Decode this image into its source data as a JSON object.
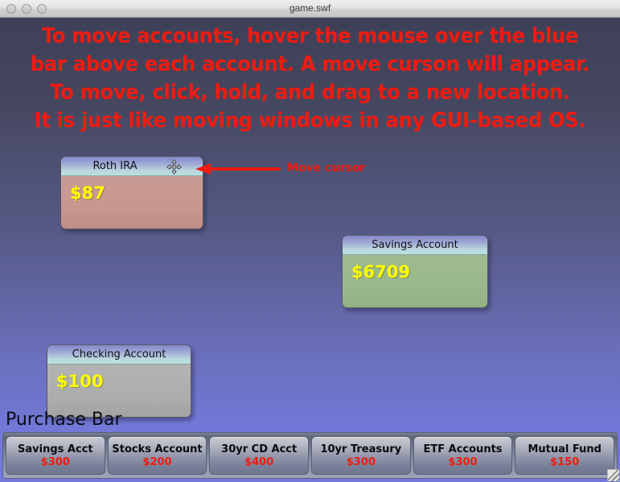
{
  "window": {
    "title": "game.swf",
    "buttons": [
      "close",
      "minimize",
      "zoom"
    ]
  },
  "instructions": {
    "line1": "To move accounts, hover the mouse over the blue",
    "line2": "bar above each account. A move curson will appear.",
    "line3": "To move, click, hold, and drag to a new location.",
    "line4": "It is just like moving windows in any GUI-based OS.",
    "color": "#f01b10"
  },
  "annotation": {
    "label": "Move cursor",
    "color": "#f01b10",
    "cursor_icon": "move-cursor-icon"
  },
  "accounts": [
    {
      "name": "Roth IRA",
      "amount": "$87",
      "body_color": "#c9968f",
      "has_move_cursor": true
    },
    {
      "name": "Savings Account",
      "amount": "$6709",
      "body_color": "#9ab98b",
      "has_move_cursor": false
    },
    {
      "name": "Checking Account",
      "amount": "$100",
      "body_color": "#adadad",
      "has_move_cursor": false
    }
  ],
  "purchase_bar": {
    "title": "Purchase Bar",
    "items": [
      {
        "label": "Savings Acct",
        "price": "$300"
      },
      {
        "label": "Stocks Account",
        "price": "$200"
      },
      {
        "label": "30yr CD Acct",
        "price": "$400"
      },
      {
        "label": "10yr Treasury",
        "price": "$300"
      },
      {
        "label": "ETF Accounts",
        "price": "$300"
      },
      {
        "label": "Mutual Fund",
        "price": "$150"
      }
    ],
    "price_color": "#f01b10"
  },
  "stage": {
    "gradient_top": "#3e4058",
    "gradient_bottom": "#7379dc"
  }
}
